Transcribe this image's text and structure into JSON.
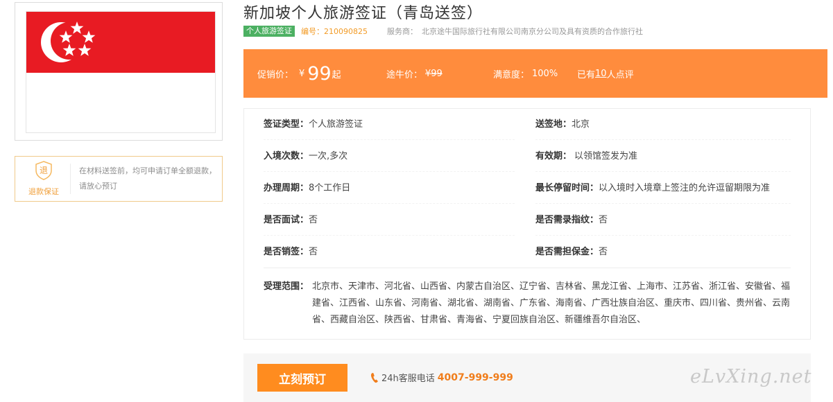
{
  "product": {
    "title": "新加坡个人旅游签证（青岛送签）",
    "tag": "个人旅游签证",
    "code_label": "编号：",
    "code": "210090825",
    "provider_label": "服务商：",
    "provider": "北京途牛国际旅行社有限公司南京分公司及具有资质的合作旅行社"
  },
  "flag": {
    "country_icon": "singapore-flag",
    "red": "#e81b23",
    "white": "#ffffff"
  },
  "guarantee": {
    "badge_char": "退",
    "badge_label": "退款保证",
    "text": "在材料送签前，均可申请订单全额退款，请放心预订"
  },
  "price_bar": {
    "promo_label": "促销价：",
    "currency": "¥",
    "promo_price": "99",
    "promo_suffix": "起",
    "tuniu_label": "途牛价：",
    "tuniu_price": "¥99",
    "satisfaction_label": "满意度：",
    "satisfaction": "100%",
    "reviews_prefix": "已有",
    "reviews_count": "10",
    "reviews_suffix": "人点评",
    "color": "#ff8c3d"
  },
  "details": {
    "visa_type": {
      "label": "签证类型：",
      "value": "个人旅游签证"
    },
    "submit_place": {
      "label": "送签地：",
      "value": "北京"
    },
    "entries": {
      "label": "入境次数：",
      "value": "一次,多次"
    },
    "validity": {
      "label": "有效期：",
      "value": "以领馆签发为准"
    },
    "processing": {
      "label": "办理周期：",
      "value": "8个工作日"
    },
    "max_stay": {
      "label": "最长停留时间：",
      "value": "以入境时入境章上签注的允许逗留期限为准"
    },
    "interview": {
      "label": "是否面试：",
      "value": "否"
    },
    "fingerprint": {
      "label": "是否需录指纹：",
      "value": "否"
    },
    "cancel": {
      "label": "是否销签：",
      "value": "否"
    },
    "deposit": {
      "label": "是否需担保金：",
      "value": "否"
    }
  },
  "scope": {
    "label": "受理范围：",
    "value": "北京市、天津市、河北省、山西省、内蒙古自治区、辽宁省、吉林省、黑龙江省、上海市、江苏省、浙江省、安徽省、福建省、江西省、山东省、河南省、湖北省、湖南省、广东省、海南省、广西壮族自治区、重庆市、四川省、贵州省、云南省、西藏自治区、陕西省、甘肃省、青海省、宁夏回族自治区、新疆维吾尔自治区、"
  },
  "actions": {
    "book_label": "立刻预订",
    "hotline_label": "24h客服电话",
    "hotline_number": "4007-999-999",
    "accent": "#ff8c1f"
  },
  "watermark": "eLvXing.net"
}
